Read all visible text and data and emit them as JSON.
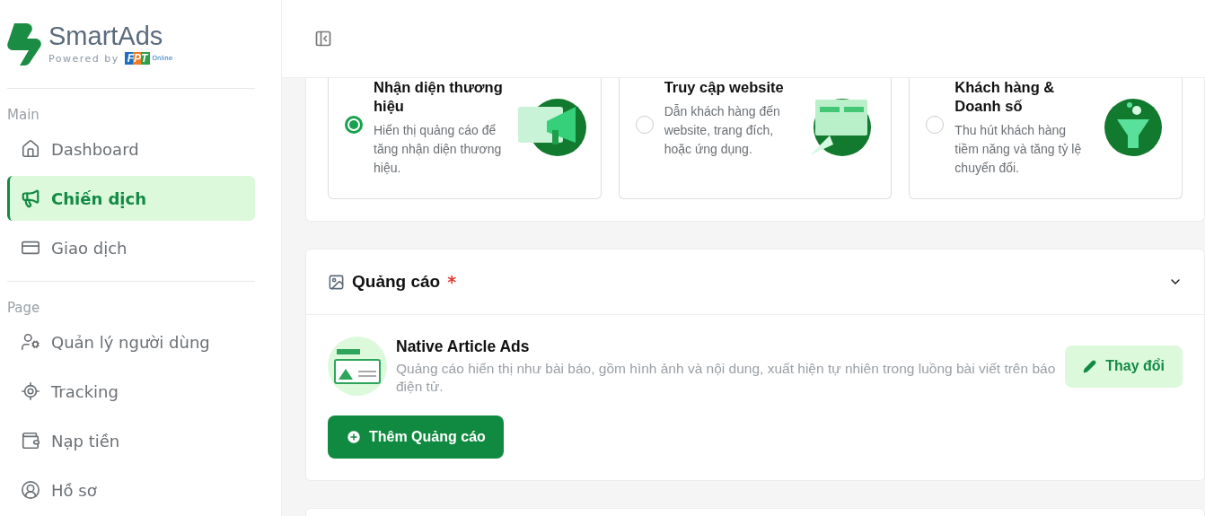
{
  "brand": {
    "name": "SmartAds",
    "powered_by": "Powered by",
    "partner": "FPT",
    "partner_suffix": "Online"
  },
  "sidebar": {
    "sections": [
      {
        "title": "Main",
        "items": [
          {
            "label": "Dashboard",
            "selected": false
          },
          {
            "label": "Chiến dịch",
            "selected": true
          },
          {
            "label": "Giao dịch",
            "selected": false
          }
        ]
      },
      {
        "title": "Page",
        "items": [
          {
            "label": "Quản lý người dùng",
            "selected": false
          },
          {
            "label": "Tracking",
            "selected": false
          },
          {
            "label": "Nạp tiền",
            "selected": false
          },
          {
            "label": "Hồ sơ",
            "selected": false
          }
        ]
      }
    ]
  },
  "objectives": [
    {
      "title": "Nhận diện thương hiệu",
      "description": "Hiển thị quảng cáo để tăng nhận diện thương hiệu.",
      "selected": true
    },
    {
      "title": "Truy cập website",
      "description": "Dẫn khách hàng đến website, trang đích, hoặc ứng dụng.",
      "selected": false
    },
    {
      "title": "Khách hàng & Doanh số",
      "description": "Thu hút khách hàng tiềm năng và tăng tỷ lệ chuyển đổi.",
      "selected": false
    }
  ],
  "ads_section": {
    "title": "Quảng cáo",
    "required_mark": "*",
    "expanded": true,
    "ad": {
      "name": "Native Article Ads",
      "description": "Quảng cáo hiển thị như bài báo, gồm hình ảnh và nội dung, xuất hiện tự nhiên trong luồng bài viết trên báo điện tử.",
      "change_button": "Thay đổi"
    },
    "add_button": "Thêm Quảng cáo"
  }
}
